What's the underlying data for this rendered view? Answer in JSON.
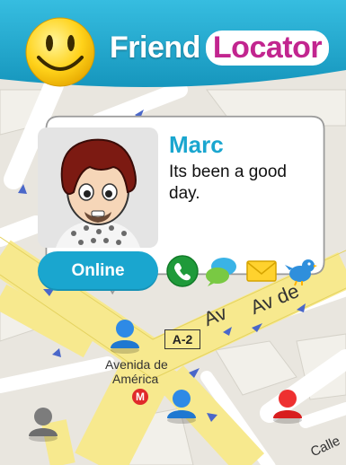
{
  "app": {
    "title_part1": "Friend",
    "title_part2": "Locator"
  },
  "profile": {
    "name": "Marc",
    "status_message": "Its been a good day.",
    "presence": "Online",
    "actions": [
      {
        "id": "call",
        "icon": "phone-icon"
      },
      {
        "id": "chat",
        "icon": "chat-bubbles-icon"
      },
      {
        "id": "email",
        "icon": "envelope-icon"
      },
      {
        "id": "twitter",
        "icon": "twitter-bird-icon"
      }
    ]
  },
  "map": {
    "road_sign": "A-2",
    "street_av": "Av de",
    "street_av2": "Av",
    "place_line1": "Avenida de",
    "place_line2": "América",
    "street_calle": "Calle",
    "metro_glyph": "M"
  },
  "colors": {
    "header": "#20a3c8",
    "accent": "#1aa6cf",
    "brand_pink": "#c2258f",
    "friend_blue": "#1f78d1",
    "friend_red": "#e02020",
    "friend_gray": "#6d6d6d"
  }
}
